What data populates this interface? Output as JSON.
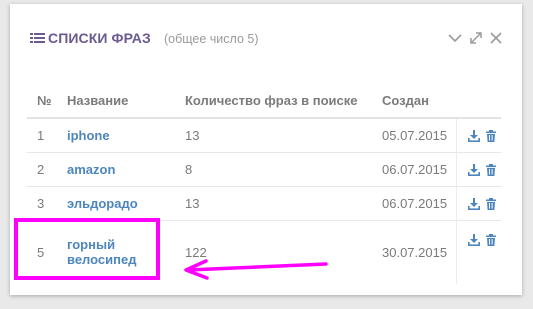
{
  "panel": {
    "title": "СПИСКИ ФРАЗ",
    "subtitle": "(общее число 5)",
    "title_icon": "list-icon",
    "header_icons": [
      "chevron-down-icon",
      "expand-icon",
      "close-icon"
    ],
    "accent_color": "#6a5a8f",
    "link_color": "#4c86bd"
  },
  "table": {
    "columns": {
      "num": "№",
      "name": "Название",
      "count": "Количество фраз в поиске",
      "created": "Создан"
    },
    "rows": [
      {
        "num": "1",
        "name": "iphone",
        "count": "13",
        "created": "05.07.2015"
      },
      {
        "num": "2",
        "name": "amazon",
        "count": "8",
        "created": "06.07.2015"
      },
      {
        "num": "3",
        "name": "эльдорадо",
        "count": "13",
        "created": "06.07.2015"
      },
      {
        "num": "5",
        "name": "горный велосипед",
        "count": "122",
        "created": "30.07.2015"
      }
    ],
    "row_actions": [
      "download-icon",
      "trash-icon"
    ]
  },
  "annotation": {
    "highlight_color": "#ff00ff",
    "highlighted_row": "5",
    "arrow_direction": "left"
  }
}
